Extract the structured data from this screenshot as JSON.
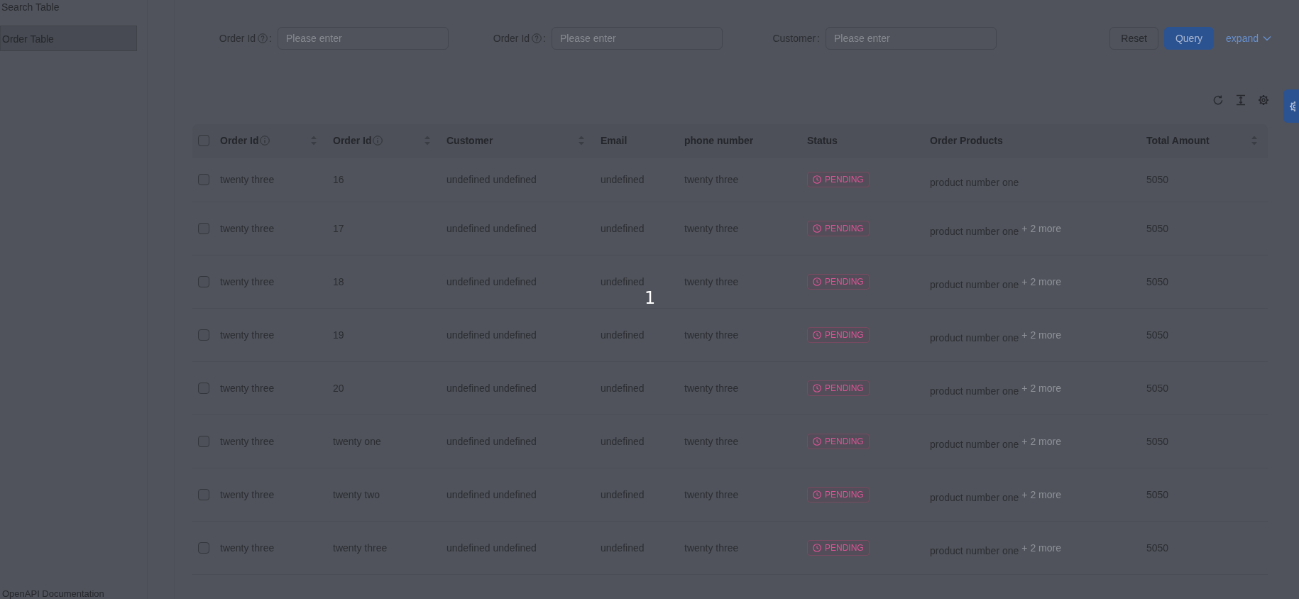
{
  "sidebar": {
    "title": "Search Table",
    "items": [
      {
        "label": "Order Table",
        "selected": true
      }
    ],
    "footer_link": "OpenAPI Documentation"
  },
  "search_form": {
    "fields": [
      {
        "label": "Order Id",
        "help": true,
        "colon": ":",
        "placeholder": "Please enter"
      },
      {
        "label": "Order Id",
        "help": true,
        "colon": ":",
        "placeholder": "Please enter"
      },
      {
        "label": "Customer",
        "help": false,
        "colon": ":",
        "placeholder": "Please enter"
      }
    ],
    "buttons": [
      {
        "label": "Reset",
        "kind": "default"
      },
      {
        "label": "Query",
        "kind": "primary"
      }
    ],
    "expand": {
      "label": "expand",
      "expanded": false
    }
  },
  "table": {
    "all_selected": false,
    "columns": [
      {
        "title": "Order Id",
        "info": true,
        "sortable": true,
        "kind": "text"
      },
      {
        "title": "Order Id",
        "info": true,
        "sortable": true,
        "kind": "text"
      },
      {
        "title": "Customer",
        "info": false,
        "sortable": true,
        "kind": "text"
      },
      {
        "title": "Email",
        "info": false,
        "sortable": false,
        "kind": "text"
      },
      {
        "title": "phone number",
        "info": false,
        "sortable": false,
        "kind": "text"
      },
      {
        "title": "Status",
        "info": false,
        "sortable": false,
        "kind": "tag"
      },
      {
        "title": "Order Products",
        "info": false,
        "sortable": false,
        "kind": "products"
      },
      {
        "title": "Total Amount",
        "info": false,
        "sortable": true,
        "kind": "text"
      }
    ],
    "rows": [
      {
        "selected": false,
        "cells": [
          "twenty three",
          "16",
          "undefined undefined",
          "undefined",
          "twenty three",
          "PENDING",
          "product number one",
          "5050"
        ]
      },
      {
        "selected": false,
        "cells": [
          "twenty three",
          "17",
          "undefined undefined",
          "undefined",
          "twenty three",
          "PENDING",
          "product number one",
          "5050"
        ],
        "more": "+ 2 more"
      },
      {
        "selected": false,
        "cells": [
          "twenty three",
          "18",
          "undefined undefined",
          "undefined",
          "twenty three",
          "PENDING",
          "product number one",
          "5050"
        ],
        "more": "+ 2 more"
      },
      {
        "selected": false,
        "cells": [
          "twenty three",
          "19",
          "undefined undefined",
          "undefined",
          "twenty three",
          "PENDING",
          "product number one",
          "5050"
        ],
        "more": "+ 2 more"
      },
      {
        "selected": false,
        "cells": [
          "twenty three",
          "20",
          "undefined undefined",
          "undefined",
          "twenty three",
          "PENDING",
          "product number one",
          "5050"
        ],
        "more": "+ 2 more"
      },
      {
        "selected": false,
        "cells": [
          "twenty three",
          "twenty one",
          "undefined undefined",
          "undefined",
          "twenty three",
          "PENDING",
          "product number one",
          "5050"
        ],
        "more": "+ 2 more"
      },
      {
        "selected": false,
        "cells": [
          "twenty three",
          "twenty two",
          "undefined undefined",
          "undefined",
          "twenty three",
          "PENDING",
          "product number one",
          "5050"
        ],
        "more": "+ 2 more"
      },
      {
        "selected": false,
        "cells": [
          "twenty three",
          "twenty three",
          "undefined undefined",
          "undefined",
          "twenty three",
          "PENDING",
          "product number one",
          "5050"
        ],
        "more": "+ 2 more"
      }
    ]
  },
  "overlay_label": "1"
}
